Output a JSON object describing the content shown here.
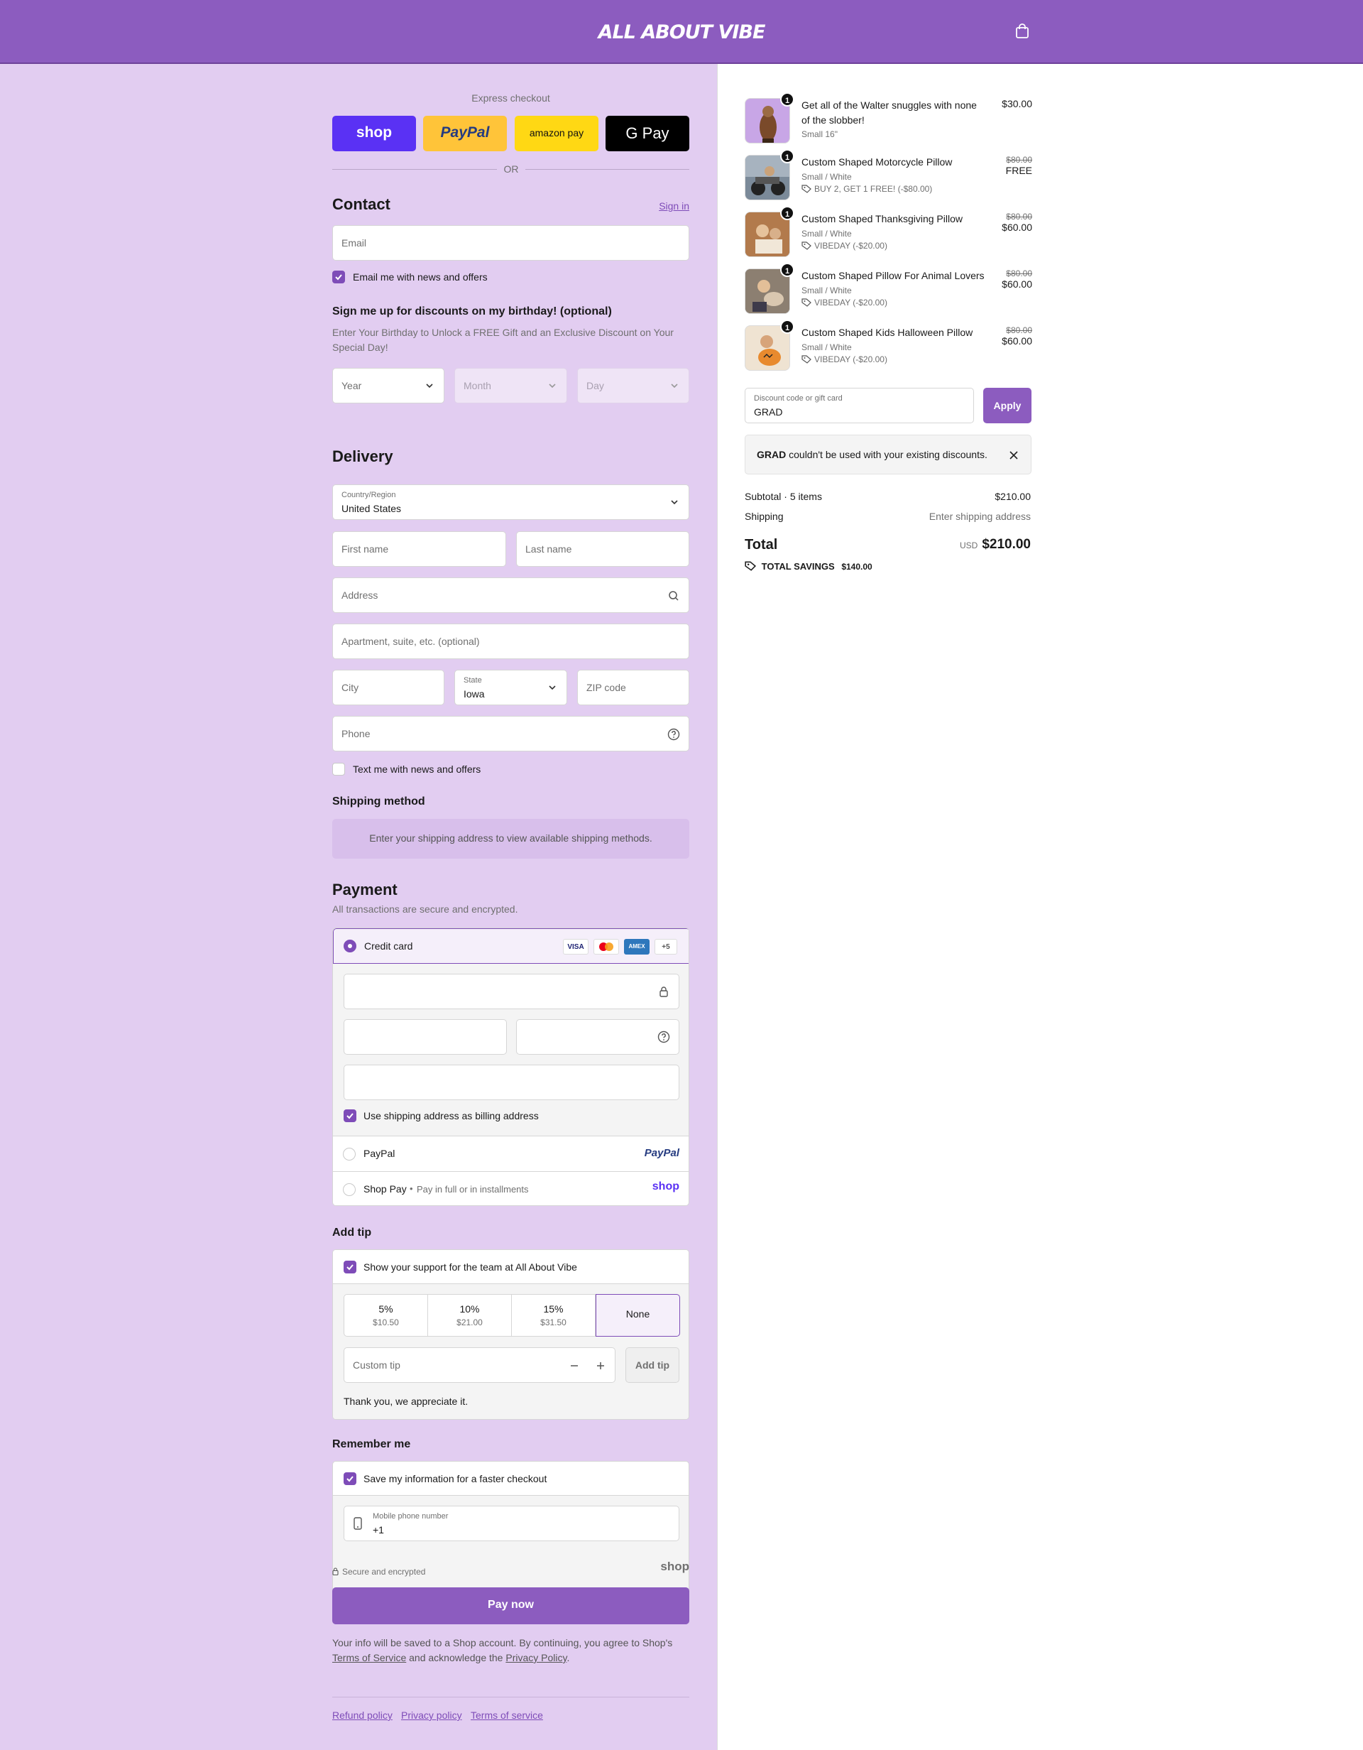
{
  "header": {
    "logo": "ALL ABOUT VIBE"
  },
  "express": {
    "title": "Express checkout",
    "buttons": {
      "shop": "shop",
      "paypal": "PayPal",
      "amazon": "amazon pay",
      "gpay": "G Pay"
    },
    "or": "OR"
  },
  "contact": {
    "title": "Contact",
    "sign_in": "Sign in",
    "email_placeholder": "Email",
    "news_label": "Email me with news and offers"
  },
  "birthday": {
    "title": "Sign me up for discounts on my birthday! (optional)",
    "desc_line1": "Enter Your Birthday to Unlock a FREE Gift and an Exclusive Discount on Your",
    "desc_line2": "Special Day!",
    "year": "Year",
    "month": "Month",
    "day": "Day"
  },
  "delivery": {
    "title": "Delivery",
    "country_label": "Country/Region",
    "country_value": "United States",
    "first_name": "First name",
    "last_name": "Last name",
    "address": "Address",
    "apartment": "Apartment, suite, etc. (optional)",
    "city": "City",
    "state_label": "State",
    "state_value": "Iowa",
    "zip": "ZIP code",
    "phone": "Phone",
    "text_label": "Text me with news and offers"
  },
  "shipping_method": {
    "title": "Shipping method",
    "message": "Enter your shipping address to view available shipping methods."
  },
  "payment": {
    "title": "Payment",
    "subtitle": "All transactions are secure and encrypted.",
    "credit_card": "Credit card",
    "card_logos": {
      "visa": "VISA",
      "amex": "AMEX",
      "more": "+5"
    },
    "billing_label": "Use shipping address as billing address",
    "paypal": "PayPal",
    "paypal_logo": "PayPal",
    "shop_pay": "Shop Pay",
    "shop_pay_sub": "Pay in full or in installments",
    "shop_logo": "shop"
  },
  "tip": {
    "title": "Add tip",
    "support_label": "Show your support for the team at All About Vibe",
    "options": [
      {
        "percent": "5%",
        "amount": "$10.50"
      },
      {
        "percent": "10%",
        "amount": "$21.00"
      },
      {
        "percent": "15%",
        "amount": "$31.50"
      },
      {
        "percent": "None",
        "amount": ""
      }
    ],
    "custom_placeholder": "Custom tip",
    "add_button": "Add tip",
    "thanks": "Thank you, we appreciate it."
  },
  "remember": {
    "title": "Remember me",
    "save_label": "Save my information for a faster checkout",
    "mobile_label": "Mobile phone number",
    "mobile_value": "+1"
  },
  "footer": {
    "secure": "Secure and encrypted",
    "shop_logo": "shop",
    "pay_now": "Pay now",
    "legal_line1": "Your info will be saved to a Shop account. By continuing, you agree to Shop's",
    "terms": "Terms of Service",
    "legal_mid": " and acknowledge the ",
    "privacy": "Privacy Policy",
    "legal_end": ".",
    "links": [
      "Refund policy",
      "Privacy policy",
      "Terms of service"
    ]
  },
  "cart": {
    "items": [
      {
        "qty": "1",
        "name": "Get all of the Walter snuggles with none of the slobber!",
        "variant": "Small 16\"",
        "discount": "",
        "original": "",
        "price": "$30.00"
      },
      {
        "qty": "1",
        "name": "Custom Shaped Motorcycle Pillow",
        "variant": "Small / White",
        "discount": "BUY 2, GET 1 FREE! (-$80.00)",
        "original": "$80.00",
        "price": "FREE"
      },
      {
        "qty": "1",
        "name": "Custom Shaped Thanksgiving Pillow",
        "variant": "Small / White",
        "discount": "VIBEDAY (-$20.00)",
        "original": "$80.00",
        "price": "$60.00"
      },
      {
        "qty": "1",
        "name": "Custom Shaped Pillow For Animal Lovers",
        "variant": "Small / White",
        "discount": "VIBEDAY (-$20.00)",
        "original": "$80.00",
        "price": "$60.00"
      },
      {
        "qty": "1",
        "name": "Custom Shaped Kids Halloween Pillow",
        "variant": "Small / White",
        "discount": "VIBEDAY (-$20.00)",
        "original": "$80.00",
        "price": "$60.00"
      }
    ],
    "discount_label": "Discount code or gift card",
    "discount_value": "GRAD",
    "apply": "Apply",
    "error_code": "GRAD",
    "error_text": " couldn't be used with your existing discounts.",
    "subtotal_label": "Subtotal · 5 items",
    "subtotal_value": "$210.00",
    "shipping_label": "Shipping",
    "shipping_value": "Enter shipping address",
    "total_label": "Total",
    "currency": "USD",
    "total_value": "$210.00",
    "savings_label": "TOTAL SAVINGS",
    "savings_value": "$140.00"
  },
  "colors": {
    "brand": "#8c5cbf",
    "accent": "#7e4cb8",
    "left_bg": "#e2cdf1",
    "shop_blue": "#5a31f4",
    "paypal_yellow": "#ffc439",
    "amazon_yellow": "#ffd814"
  }
}
